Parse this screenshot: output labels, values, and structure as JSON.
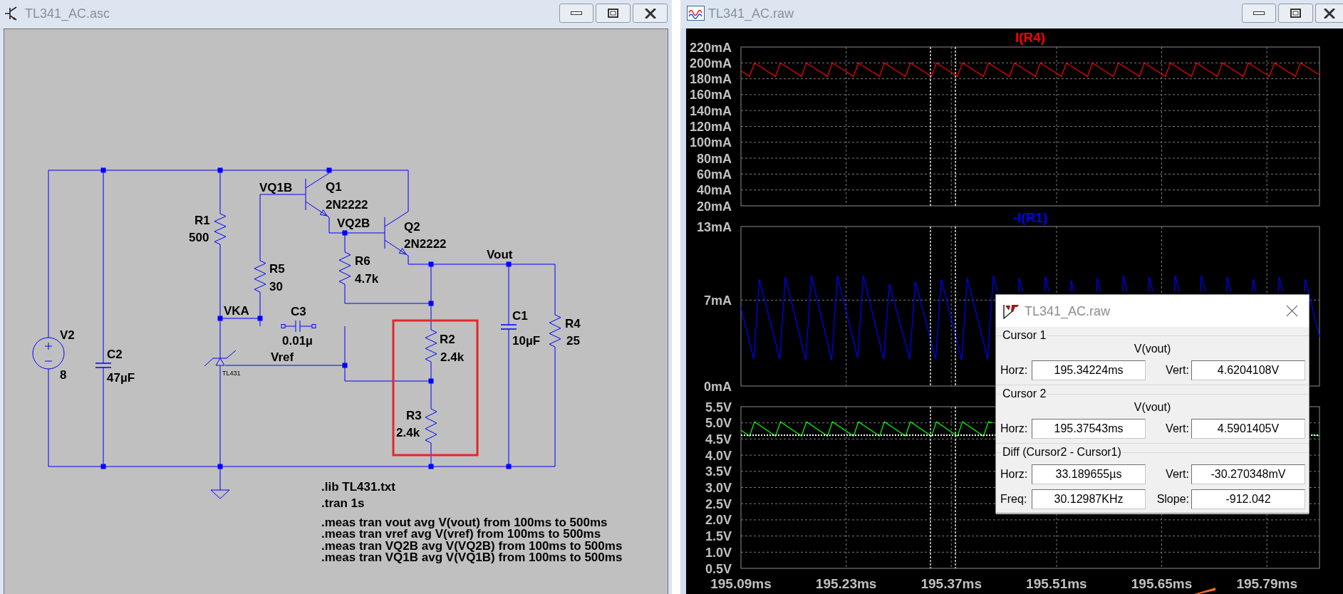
{
  "schematic_window": {
    "title": "TL341_AC.asc"
  },
  "schematic": {
    "components": [
      {
        "kind": "voltage_source",
        "ref": "V2",
        "value": "8"
      },
      {
        "kind": "capacitor",
        "ref": "C2",
        "value": "47µF"
      },
      {
        "kind": "resistor",
        "ref": "R1",
        "value": "500"
      },
      {
        "kind": "resistor",
        "ref": "R5",
        "value": "30"
      },
      {
        "kind": "npn",
        "ref": "Q1",
        "value": "2N2222"
      },
      {
        "kind": "npn",
        "ref": "Q2",
        "value": "2N2222"
      },
      {
        "kind": "resistor",
        "ref": "R6",
        "value": "4.7k"
      },
      {
        "kind": "capacitor",
        "ref": "C3",
        "value": "0.01µ"
      },
      {
        "kind": "shunt_regulator",
        "value": "TL431"
      },
      {
        "kind": "resistor",
        "ref": "R2",
        "value": "2.4k"
      },
      {
        "kind": "resistor",
        "ref": "R3",
        "value": "2.4k"
      },
      {
        "kind": "capacitor",
        "ref": "C1",
        "value": "10µF"
      },
      {
        "kind": "resistor",
        "ref": "R4",
        "value": "25"
      }
    ],
    "net_labels": [
      "VQ1B",
      "VQ2B",
      "Vout",
      "VKA",
      "Vref"
    ],
    "directives": [
      ".lib TL431.txt",
      ".tran 1s",
      ".meas tran vout avg V(vout) from 100ms to 500ms",
      ".meas tran vref avg V(vref) from 100ms to 500ms",
      ".meas tran VQ2B avg V(VQ2B) from 100ms to 500ms",
      ".meas tran VQ1B avg V(VQ1B) from 100ms to 500ms"
    ]
  },
  "waveform_window": {
    "title": "TL341_AC.raw"
  },
  "plot_panes": [
    {
      "chart_data": {
        "type": "line",
        "grid": true,
        "xlim": [
          195.09,
          195.86
        ],
        "ylim": [
          20,
          220
        ],
        "yticks": [
          {
            "value": 20,
            "label": "20mA"
          },
          {
            "value": 40,
            "label": "40mA"
          },
          {
            "value": 60,
            "label": "60mA"
          },
          {
            "value": 80,
            "label": "80mA"
          },
          {
            "value": 100,
            "label": "100mA"
          },
          {
            "value": 120,
            "label": "120mA"
          },
          {
            "value": 140,
            "label": "140mA"
          },
          {
            "value": 160,
            "label": "160mA"
          },
          {
            "value": 180,
            "label": "180mA"
          },
          {
            "value": 200,
            "label": "200mA"
          },
          {
            "value": 220,
            "label": "220mA"
          }
        ],
        "x": [
          195.09,
          195.1014,
          195.108,
          195.136,
          195.1426,
          195.1706,
          195.1772,
          195.2052,
          195.2118,
          195.2398,
          195.2464,
          195.2744,
          195.281,
          195.309,
          195.3156,
          195.3436,
          195.3502,
          195.3782,
          195.3848,
          195.4128,
          195.4194,
          195.4474,
          195.454,
          195.482,
          195.4886,
          195.5166,
          195.5232,
          195.5512,
          195.5578,
          195.5858,
          195.5924,
          195.6204,
          195.627,
          195.655,
          195.6616,
          195.6896,
          195.6962,
          195.7242,
          195.7308,
          195.7588,
          195.7654,
          195.7934,
          195.8,
          195.828,
          195.8346,
          195.86
        ],
        "series": [
          {
            "name": "I(R4)",
            "color": "#ff0000",
            "values": [
              190,
              183,
              200,
              183,
              200,
              183,
              200,
              183,
              200,
              183,
              200,
              183,
              200,
              183,
              200,
              183,
              200,
              183,
              200,
              183,
              200,
              183,
              200,
              183,
              200,
              183,
              200,
              183,
              200,
              183,
              200,
              183,
              200,
              183,
              200,
              183,
              200,
              183,
              200,
              183,
              200,
              183,
              200,
              183,
              200,
              185
            ]
          }
        ],
        "ref_lines": [
          {
            "axis": "x",
            "value": 195.34224
          },
          {
            "axis": "x",
            "value": 195.37543
          }
        ]
      }
    },
    {
      "chart_data": {
        "type": "line",
        "grid": true,
        "xlim": [
          195.09,
          195.86
        ],
        "ylim": [
          0,
          13
        ],
        "yticks": [
          {
            "value": 0,
            "label": "0mA"
          },
          {
            "value": 7,
            "label": "7mA"
          },
          {
            "value": 13,
            "label": "13mA"
          }
        ],
        "x": [
          195.09,
          195.107,
          195.1145,
          195.1416,
          195.1491,
          195.1762,
          195.1837,
          195.2108,
          195.2183,
          195.2454,
          195.2529,
          195.28,
          195.2875,
          195.3146,
          195.3221,
          195.3492,
          195.3567,
          195.3838,
          195.3913,
          195.4184,
          195.4259,
          195.4312,
          195.435,
          195.4592,
          195.4605,
          195.465,
          195.47,
          195.4938,
          195.4951,
          195.5,
          195.505,
          195.5284,
          195.5297,
          195.5334,
          195.538,
          195.563,
          195.5643,
          195.5688,
          195.574,
          195.5976,
          195.5989,
          195.6042,
          195.609,
          195.6322,
          195.6335,
          195.6384,
          195.643,
          195.6668,
          195.6681,
          195.6734,
          195.678,
          195.7014,
          195.7027,
          195.708,
          195.713,
          195.736,
          195.7373,
          195.7422,
          195.747,
          195.7706,
          195.7719,
          195.776,
          195.781,
          195.8052,
          195.8065,
          195.8114,
          195.816,
          195.8398,
          195.8411,
          195.86
        ],
        "series": [
          {
            "name": "-I(R1)",
            "color": "#0000ff",
            "values": [
              6.4,
              2.2,
              8.7,
              2.2,
              8.9,
              2.1,
              9.0,
              2.1,
              9.0,
              2.3,
              9.0,
              2.2,
              8.3,
              2.2,
              8.5,
              2.2,
              8.7,
              2.1,
              8.8,
              2.2,
              9.0,
              7.7,
              null,
              7.7,
              8.8,
              7.7,
              null,
              7.7,
              8.9,
              7.7,
              null,
              7.7,
              8.6,
              7.7,
              null,
              7.7,
              8.8,
              7.7,
              null,
              7.7,
              9.0,
              7.7,
              null,
              7.7,
              8.9,
              7.7,
              null,
              7.7,
              9.0,
              7.7,
              null,
              7.7,
              9.0,
              7.7,
              null,
              7.7,
              8.9,
              7.7,
              null,
              7.7,
              8.7,
              7.7,
              null,
              7.7,
              8.9,
              7.7,
              null,
              7.7,
              8.7,
              4.0
            ]
          }
        ],
        "ref_lines": [
          {
            "axis": "x",
            "value": 195.34224
          },
          {
            "axis": "x",
            "value": 195.37543
          }
        ]
      }
    },
    {
      "chart_data": {
        "type": "line",
        "grid": true,
        "xlim": [
          195.09,
          195.86
        ],
        "ylim": [
          0.5,
          5.5
        ],
        "xticks": [
          {
            "value": 195.09,
            "label": "195.09ms"
          },
          {
            "value": 195.23,
            "label": "195.23ms"
          },
          {
            "value": 195.37,
            "label": "195.37ms"
          },
          {
            "value": 195.51,
            "label": "195.51ms"
          },
          {
            "value": 195.65,
            "label": "195.65ms"
          },
          {
            "value": 195.79,
            "label": "195.79ms"
          }
        ],
        "yticks": [
          {
            "value": 0.5,
            "label": "0.5V"
          },
          {
            "value": 1.0,
            "label": "1.0V"
          },
          {
            "value": 1.5,
            "label": "1.5V"
          },
          {
            "value": 2.0,
            "label": "2.0V"
          },
          {
            "value": 2.5,
            "label": "2.5V"
          },
          {
            "value": 3.0,
            "label": "3.0V"
          },
          {
            "value": 3.5,
            "label": "3.5V"
          },
          {
            "value": 4.0,
            "label": "4.0V"
          },
          {
            "value": 4.5,
            "label": "4.5V"
          },
          {
            "value": 5.0,
            "label": "5.0V"
          },
          {
            "value": 5.5,
            "label": "5.5V"
          }
        ],
        "x": [
          195.09,
          195.1014,
          195.108,
          195.136,
          195.1426,
          195.1706,
          195.1772,
          195.2052,
          195.2118,
          195.2398,
          195.2464,
          195.2744,
          195.281,
          195.309,
          195.3156,
          195.3436,
          195.3502,
          195.3782,
          195.3848,
          195.4128,
          195.4194,
          195.425,
          195.6,
          195.849,
          195.86
        ],
        "series": [
          {
            "color": "#00ff00",
            "values": [
              4.77,
              4.59,
              5.03,
              4.59,
              5.03,
              4.59,
              5.03,
              4.59,
              5.03,
              4.59,
              5.03,
              4.59,
              5.03,
              4.59,
              5.03,
              4.59,
              5.03,
              4.59,
              5.03,
              4.59,
              5.03,
              5.0,
              null,
              4.63,
              4.6
            ]
          }
        ],
        "ref_lines": [
          {
            "axis": "x",
            "value": 195.34224
          },
          {
            "axis": "x",
            "value": 195.37543
          },
          {
            "axis": "y",
            "value": 4.62
          }
        ]
      }
    }
  ],
  "cursor_dialog": {
    "title": "TL341_AC.raw",
    "groups": [
      {
        "label": "Cursor 1",
        "trace": "V(vout)",
        "fields": [
          {
            "label": "Horz:",
            "value": "195.34224ms"
          },
          {
            "label": "Vert:",
            "value": "4.6204108V"
          }
        ]
      },
      {
        "label": "Cursor 2",
        "trace": "V(vout)",
        "fields": [
          {
            "label": "Horz:",
            "value": "195.37543ms"
          },
          {
            "label": "Vert:",
            "value": "4.5901405V"
          }
        ]
      },
      {
        "label": "Diff (Cursor2 - Cursor1)",
        "fields": [
          {
            "label": "Horz:",
            "value": "33.189655µs"
          },
          {
            "label": "Vert:",
            "value": "-30.270348mV"
          },
          {
            "label": "Freq:",
            "value": "30.12987KHz"
          },
          {
            "label": "Slope:",
            "value": "-912.042"
          }
        ]
      }
    ]
  }
}
